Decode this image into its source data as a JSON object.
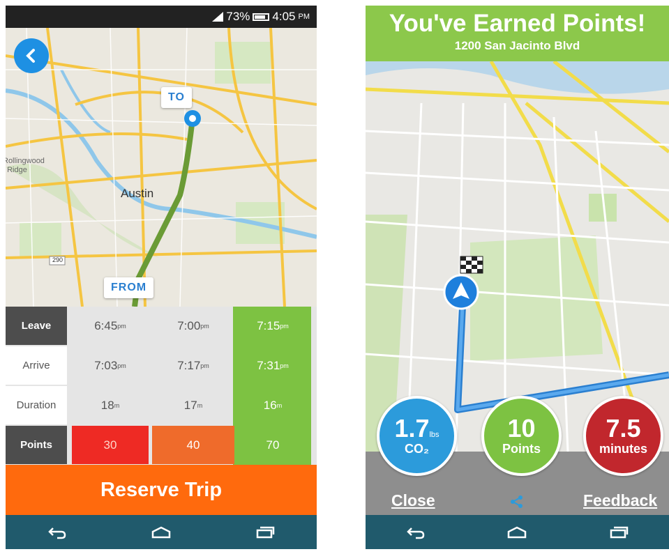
{
  "left_screen": {
    "status": {
      "battery": "73%",
      "time": "4:05",
      "ampm": "PM"
    },
    "map": {
      "to_label": "TO",
      "from_label": "FROM",
      "city": "Austin",
      "area_label": "Rollingwood / Ridge",
      "highway": "290"
    },
    "table": {
      "labels": {
        "leave": "Leave",
        "arrive": "Arrive",
        "duration": "Duration",
        "points": "Points"
      },
      "options": [
        {
          "leave": "6:45",
          "arrive": "7:03",
          "duration": "18",
          "points": "30"
        },
        {
          "leave": "7:00",
          "arrive": "7:17",
          "duration": "17",
          "points": "40"
        },
        {
          "leave": "7:15",
          "arrive": "7:31",
          "duration": "16",
          "points": "70"
        }
      ],
      "suffix_pm": "pm",
      "suffix_min": "m"
    },
    "reserve_label": "Reserve Trip"
  },
  "right_screen": {
    "header": {
      "title": "You've Earned Points!",
      "address": "1200 San Jacinto Blvd"
    },
    "stats": {
      "co2": {
        "value": "1.7",
        "unit": "lbs",
        "label": "CO₂"
      },
      "points": {
        "value": "10",
        "label": "Points"
      },
      "minutes": {
        "value": "7.5",
        "label": "minutes"
      }
    },
    "close_label": "Close",
    "feedback_label": "Feedback"
  },
  "colors": {
    "accent_blue": "#1e90e3",
    "green": "#7dc242",
    "orange": "#ff6a0d",
    "red": "#ee2a24",
    "nav": "#205a6c"
  }
}
